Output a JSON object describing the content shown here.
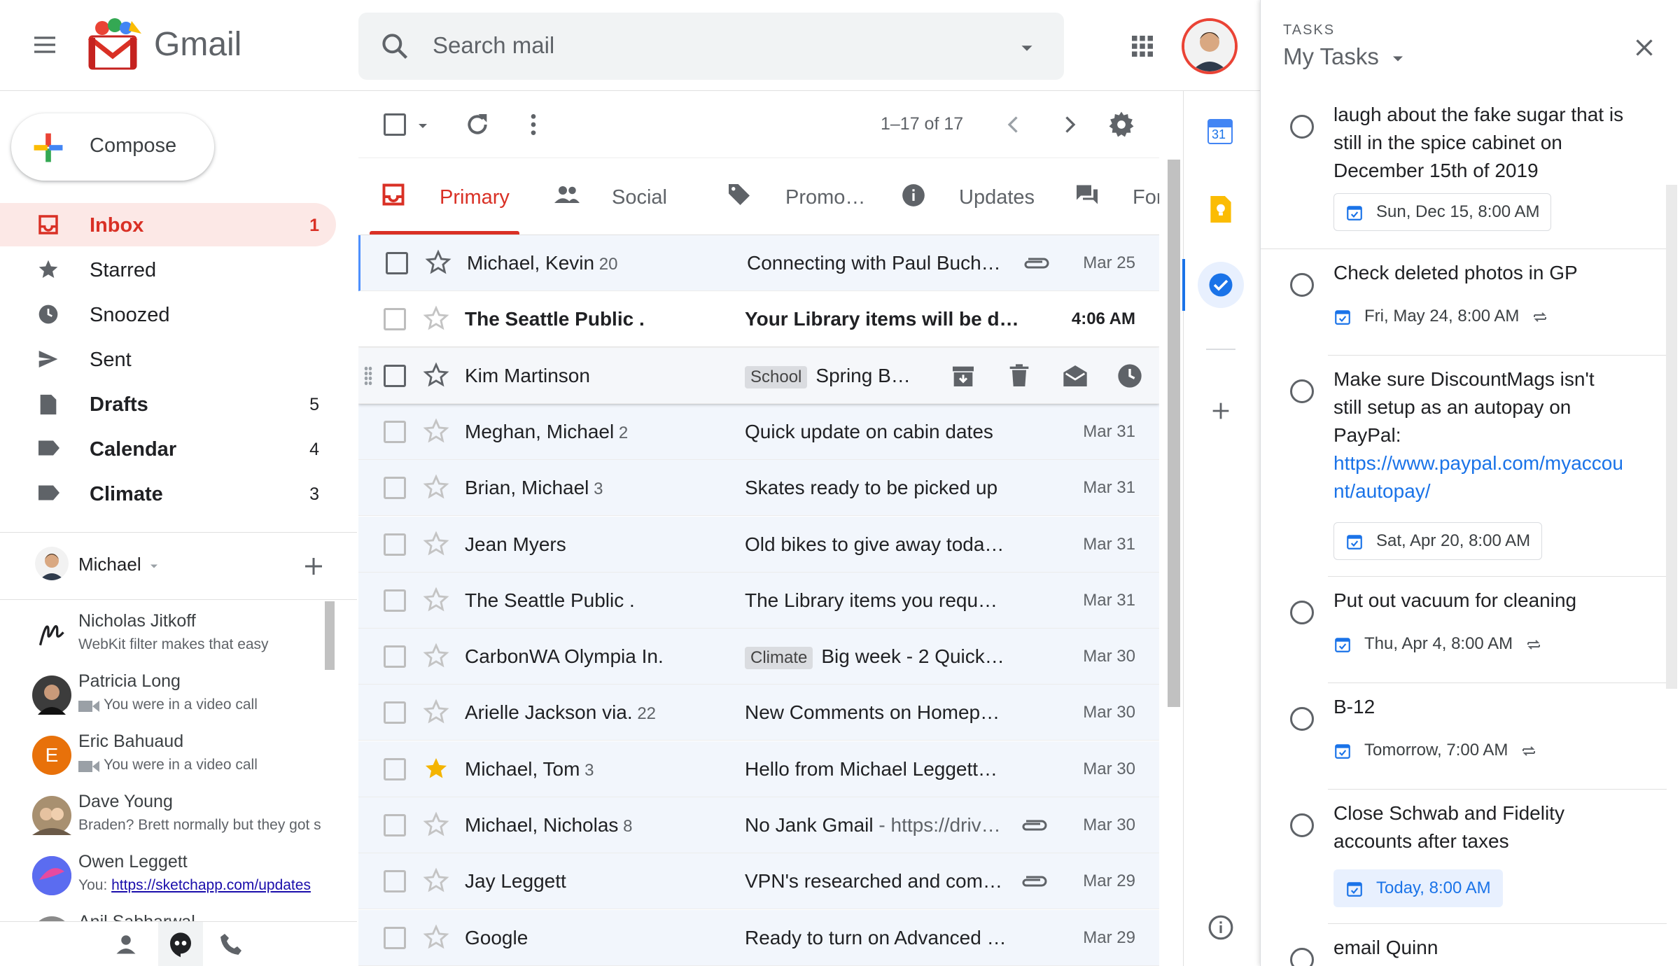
{
  "app": {
    "logo_text": "Gmail"
  },
  "search": {
    "placeholder": "Search mail"
  },
  "compose": {
    "label": "Compose"
  },
  "nav": [
    {
      "label": "Inbox",
      "count": "1",
      "icon": "inbox-icon"
    },
    {
      "label": "Starred",
      "count": "",
      "icon": "star-icon"
    },
    {
      "label": "Snoozed",
      "count": "",
      "icon": "clock-icon"
    },
    {
      "label": "Sent",
      "count": "",
      "icon": "send-icon"
    },
    {
      "label": "Drafts",
      "count": "5",
      "icon": "draft-icon"
    },
    {
      "label": "Calendar",
      "count": "4",
      "icon": "label-icon"
    },
    {
      "label": "Climate",
      "count": "3",
      "icon": "label-icon"
    }
  ],
  "hangouts": {
    "user": "Michael",
    "contacts": [
      {
        "name": "Nicholas Jitkoff",
        "sub": "WebKit filter makes that easy",
        "avatar_letter": "",
        "avatar_color": "#ffffff"
      },
      {
        "name": "Patricia Long",
        "sub": "You were in a video call",
        "avatar_letter": "",
        "avatar_color": "#3c3c3c"
      },
      {
        "name": "Eric Bahuaud",
        "sub": "You were in a video call",
        "avatar_letter": "E",
        "avatar_color": "#e8710a"
      },
      {
        "name": "Dave Young",
        "sub": "Braden? Brett normally but they got s",
        "avatar_letter": "",
        "avatar_color": "#a89070"
      },
      {
        "name": "Owen Leggett",
        "sub_prefix": "You: ",
        "sub_link": "https://sketchapp.com/updates",
        "avatar_letter": "",
        "avatar_color": "#7b3fe4"
      },
      {
        "name": "Anil Sabharwal",
        "sub": "",
        "avatar_letter": "",
        "avatar_color": "#8a8a8a"
      }
    ]
  },
  "toolbar": {
    "pager": "1–17 of 17"
  },
  "tabs": [
    {
      "label": "Primary",
      "icon": "inbox-icon"
    },
    {
      "label": "Social",
      "icon": "people-icon"
    },
    {
      "label": "Promo…",
      "icon": "tag-icon"
    },
    {
      "label": "Updates",
      "icon": "info-icon"
    },
    {
      "label": "Foru",
      "icon": "forum-icon"
    }
  ],
  "mails": [
    {
      "sender": "Michael, Kevin",
      "count": "20",
      "label": "",
      "subject": "Connecting with Paul Buch…",
      "snippet": "",
      "date": "Mar 25",
      "attachment": true,
      "unread": false,
      "starred": false
    },
    {
      "sender": "The Seattle Public .",
      "count": "",
      "label": "",
      "subject": "Your Library items will be d…",
      "snippet": "",
      "date": "4:06 AM",
      "attachment": false,
      "unread": true,
      "starred": false
    },
    {
      "sender": "Kim Martinson",
      "count": "",
      "label": "School",
      "subject": "Spring B…",
      "snippet": "",
      "date": "",
      "attachment": false,
      "unread": false,
      "starred": false
    },
    {
      "sender": "Meghan, Michael",
      "count": "2",
      "label": "",
      "subject": "Quick update on cabin dates",
      "snippet": "",
      "date": "Mar 31",
      "attachment": false,
      "unread": false,
      "starred": false
    },
    {
      "sender": "Brian, Michael",
      "count": "3",
      "label": "",
      "subject": "Skates ready to be picked up",
      "snippet": "",
      "date": "Mar 31",
      "attachment": false,
      "unread": false,
      "starred": false
    },
    {
      "sender": "Jean Myers",
      "count": "",
      "label": "",
      "subject": "Old bikes to give away toda…",
      "snippet": "",
      "date": "Mar 31",
      "attachment": false,
      "unread": false,
      "starred": false
    },
    {
      "sender": "The Seattle Public .",
      "count": "",
      "label": "",
      "subject": "The Library items you requ…",
      "snippet": "",
      "date": "Mar 31",
      "attachment": false,
      "unread": false,
      "starred": false
    },
    {
      "sender": "CarbonWA Olympia In.",
      "count": "",
      "label": "Climate",
      "subject": "Big week - 2 Quick…",
      "snippet": "",
      "date": "Mar 30",
      "attachment": false,
      "unread": false,
      "starred": false
    },
    {
      "sender": "Arielle Jackson via.",
      "count": "22",
      "label": "",
      "subject": "New Comments on Homep…",
      "snippet": "",
      "date": "Mar 30",
      "attachment": false,
      "unread": false,
      "starred": false
    },
    {
      "sender": "Michael, Tom",
      "count": "3",
      "label": "",
      "subject": "Hello from Michael Leggett…",
      "snippet": "",
      "date": "Mar 30",
      "attachment": false,
      "unread": false,
      "starred": true
    },
    {
      "sender": "Michael, Nicholas",
      "count": "8",
      "label": "",
      "subject": "No Jank Gmail",
      "snippet": " - https://driv…",
      "date": "Mar 30",
      "attachment": true,
      "unread": false,
      "starred": false
    },
    {
      "sender": "Jay Leggett",
      "count": "",
      "label": "",
      "subject": "VPN's researched and com…",
      "snippet": "",
      "date": "Mar 29",
      "attachment": true,
      "unread": false,
      "starred": false
    },
    {
      "sender": "Google",
      "count": "",
      "label": "",
      "subject": "Ready to turn on Advanced …",
      "snippet": "",
      "date": "Mar 29",
      "attachment": false,
      "unread": false,
      "starred": false
    }
  ],
  "tasks": {
    "caption": "TASKS",
    "title": "My Tasks",
    "items": [
      {
        "title": "laugh about the fake sugar that is still in the spice cabinet on December 15th of 2019",
        "date": "Sun, Dec 15, 8:00 AM",
        "repeat": false,
        "style": "chip"
      },
      {
        "title": "Check deleted photos in GP",
        "date": "Fri, May 24, 8:00 AM",
        "repeat": true,
        "style": "plain"
      },
      {
        "title": "Make sure DiscountMags isn't still setup as an autopay on PayPal:",
        "link": "https://www.paypal.com/myaccount/autopay/",
        "date": "Sat, Apr 20, 8:00 AM",
        "repeat": false,
        "style": "chip"
      },
      {
        "title": "Put out vacuum for cleaning",
        "date": "Thu, Apr 4, 8:00 AM",
        "repeat": true,
        "style": "plain"
      },
      {
        "title": "B-12",
        "date": "Tomorrow, 7:00 AM",
        "repeat": true,
        "style": "plain"
      },
      {
        "title": "Close Schwab and Fidelity accounts after taxes",
        "date": "Today, 8:00 AM",
        "repeat": false,
        "style": "today"
      },
      {
        "title": "email Quinn",
        "date": "",
        "repeat": false,
        "style": "none"
      }
    ]
  },
  "addons": {
    "calendar_day": "31"
  },
  "colors": {
    "accent": "#d93025",
    "link": "#1a73e8",
    "star": "#f4b400"
  }
}
